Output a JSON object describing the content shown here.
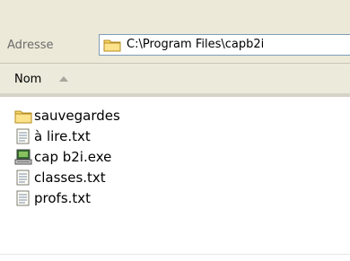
{
  "address": {
    "label": "Adresse",
    "path": "C:\\Program Files\\capb2i"
  },
  "list": {
    "column_name": "Nom",
    "sort": "ascending",
    "items": [
      {
        "name": "sauvegardes",
        "icon": "folder-icon"
      },
      {
        "name": "à lire.txt",
        "icon": "text-file-icon"
      },
      {
        "name": "cap b2i.exe",
        "icon": "application-icon"
      },
      {
        "name": "classes.txt",
        "icon": "text-file-icon"
      },
      {
        "name": "profs.txt",
        "icon": "text-file-icon"
      }
    ]
  }
}
